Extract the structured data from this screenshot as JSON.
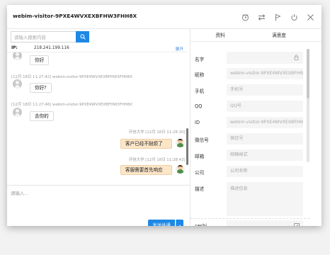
{
  "window": {
    "title": "webim-visitor-9PXE4WVXEXBFHW3FHH8X",
    "toolbar_icons": [
      "history-icon",
      "transfer-icon",
      "flag-icon",
      "power-icon",
      "close-icon"
    ]
  },
  "chat": {
    "search_placeholder": "请输入搜索内容",
    "ip_label": "IP:",
    "ip_value": "218.241.199.116",
    "expand_label": "展开",
    "messages": [
      {
        "meta": "",
        "text": "你好",
        "from": "visitor"
      },
      {
        "meta": "[12月 18日 11:27:42] webim-visitor-9PXE4WVXEXBFHW3FHH8X",
        "text": "你好?",
        "from": "visitor"
      },
      {
        "meta": "[12月 18日 11:27:46] webim-visitor-9PXE4WVXEXBFHW3FHH8X",
        "text": "去你的",
        "from": "visitor"
      },
      {
        "meta": "环信大学 [12月 18日 11:28:30]",
        "text": "客户已经不耐烦了",
        "from": "agent"
      },
      {
        "meta": "环信大学 [12月 18日 11:28:43]",
        "text": "客服需要首先响应",
        "from": "agent"
      }
    ],
    "input_placeholder": "请输入...",
    "send_label": "发送并通",
    "send_dropdown": "⌄"
  },
  "panel": {
    "tabs": [
      "资料",
      "满意度"
    ],
    "fields": [
      {
        "label": "名字",
        "value": ""
      },
      {
        "label": "昵称",
        "value": "webim-visitor-9PXE4WVXEXBFHW3FHH8X"
      },
      {
        "label": "手机",
        "value": "手机号"
      },
      {
        "label": "QQ",
        "value": "QQ号"
      },
      {
        "label": "ID",
        "value": "webim-visitor-9PXE4WVXEXBFHW3FHH8X"
      },
      {
        "label": "微信号",
        "value": "微信号"
      },
      {
        "label": "邮箱",
        "value": "邮箱格式"
      },
      {
        "label": "公司",
        "value": "公司名称"
      },
      {
        "label": "描述",
        "value": "描述信息"
      }
    ],
    "bottom_label": "ceshi",
    "colors": {
      "accent": "#1e88e5",
      "agent_bubble": "#fbe6c8"
    }
  }
}
